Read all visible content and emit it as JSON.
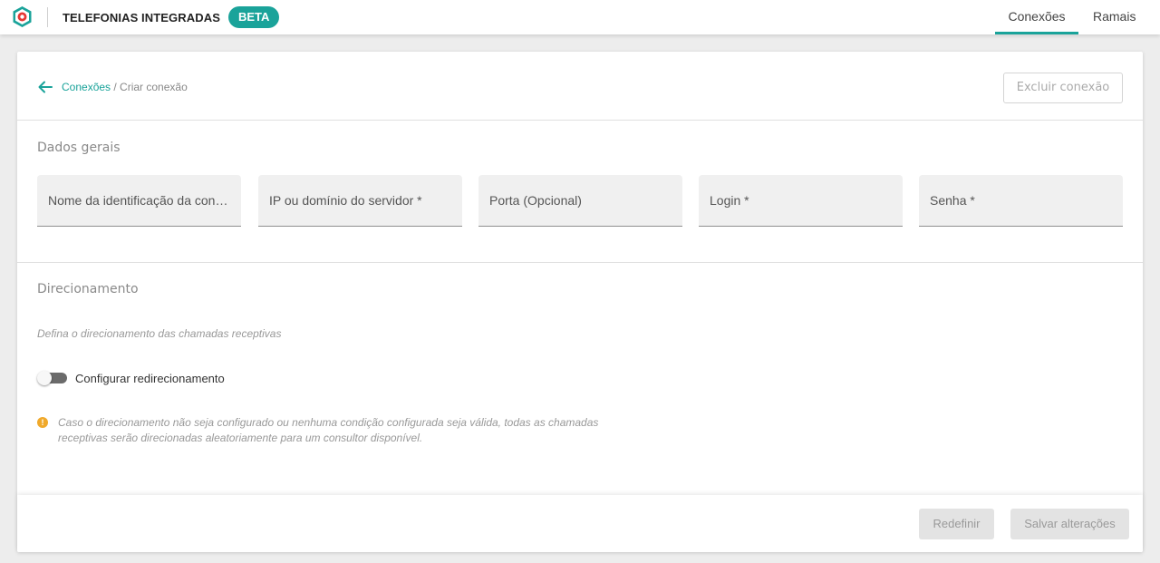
{
  "header": {
    "app_title": "TELEFONIAS INTEGRADAS",
    "badge": "BETA",
    "accent_color": "#1aa39a",
    "logo_color": "#e53935",
    "nav": [
      {
        "label": "Conexões",
        "active": true
      },
      {
        "label": "Ramais",
        "active": false
      }
    ]
  },
  "card": {
    "breadcrumb": {
      "back_icon": "arrow-left-icon",
      "link": "Conexões",
      "current": " / Criar conexão"
    },
    "delete_button": "Excluir conexão",
    "section_general": {
      "title": "Dados gerais",
      "fields": [
        {
          "label": "Nome da identificação da conexão *"
        },
        {
          "label": "IP ou domínio do servidor *"
        },
        {
          "label": "Porta (Opcional)"
        },
        {
          "label": "Login *"
        },
        {
          "label": "Senha *"
        }
      ]
    },
    "section_routing": {
      "title": "Direcionamento",
      "description": "Defina o direcionamento das chamadas receptivas",
      "toggle": {
        "label": "Configurar redirecionamento",
        "checked": false
      },
      "info_icon": "info-icon",
      "info_color": "#f0a92b",
      "info_text": "Caso o direcionamento não seja configurado ou nenhuma condição configurada seja válida, todas as chamadas receptivas serão direcionadas aleatoriamente para um consultor disponível."
    },
    "footer": {
      "reset_button": "Redefinir",
      "save_button": "Salvar alterações"
    }
  }
}
